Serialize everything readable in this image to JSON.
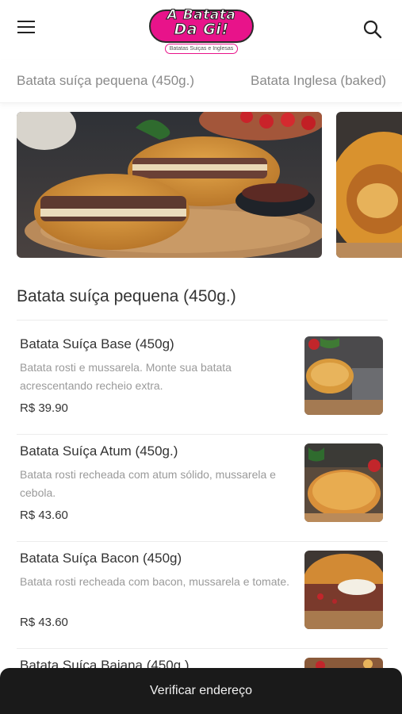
{
  "header": {
    "menu_icon": "hamburger-menu-icon",
    "search_icon": "search-icon",
    "logo": {
      "line1": "A Batata",
      "line2": "Da Gi!",
      "subtitle": "Batatas Suiças e Inglesas"
    }
  },
  "tabs": [
    {
      "label": "Batata suíça pequena (450g.)"
    },
    {
      "label": "Batata Inglesa (baked)"
    }
  ],
  "section": {
    "title": "Batata suíça pequena (450g.)"
  },
  "items": [
    {
      "name": "Batata Suíça Base (450g)",
      "description": "Batata rosti e mussarela. Monte sua batata acrescentando recheio extra.",
      "price": "R$ 39.90"
    },
    {
      "name": "Batata Suíça Atum (450g.)",
      "description": "Batata rosti recheada com atum sólido, mussarela e cebola.",
      "price": "R$ 43.60"
    },
    {
      "name": "Batata Suíça Bacon (450g)",
      "description": "Batata rosti recheada com bacon, mussarela e tomate.",
      "price": "R$ 43.60"
    },
    {
      "name": "Batata Suíça Baiana (450g.)"
    }
  ],
  "footer": {
    "button_label": "Verificar endereço"
  },
  "colors": {
    "brand_pink": "#e8138a",
    "footer_bg": "#1a1a1a",
    "muted_text": "#9a9a9a"
  }
}
